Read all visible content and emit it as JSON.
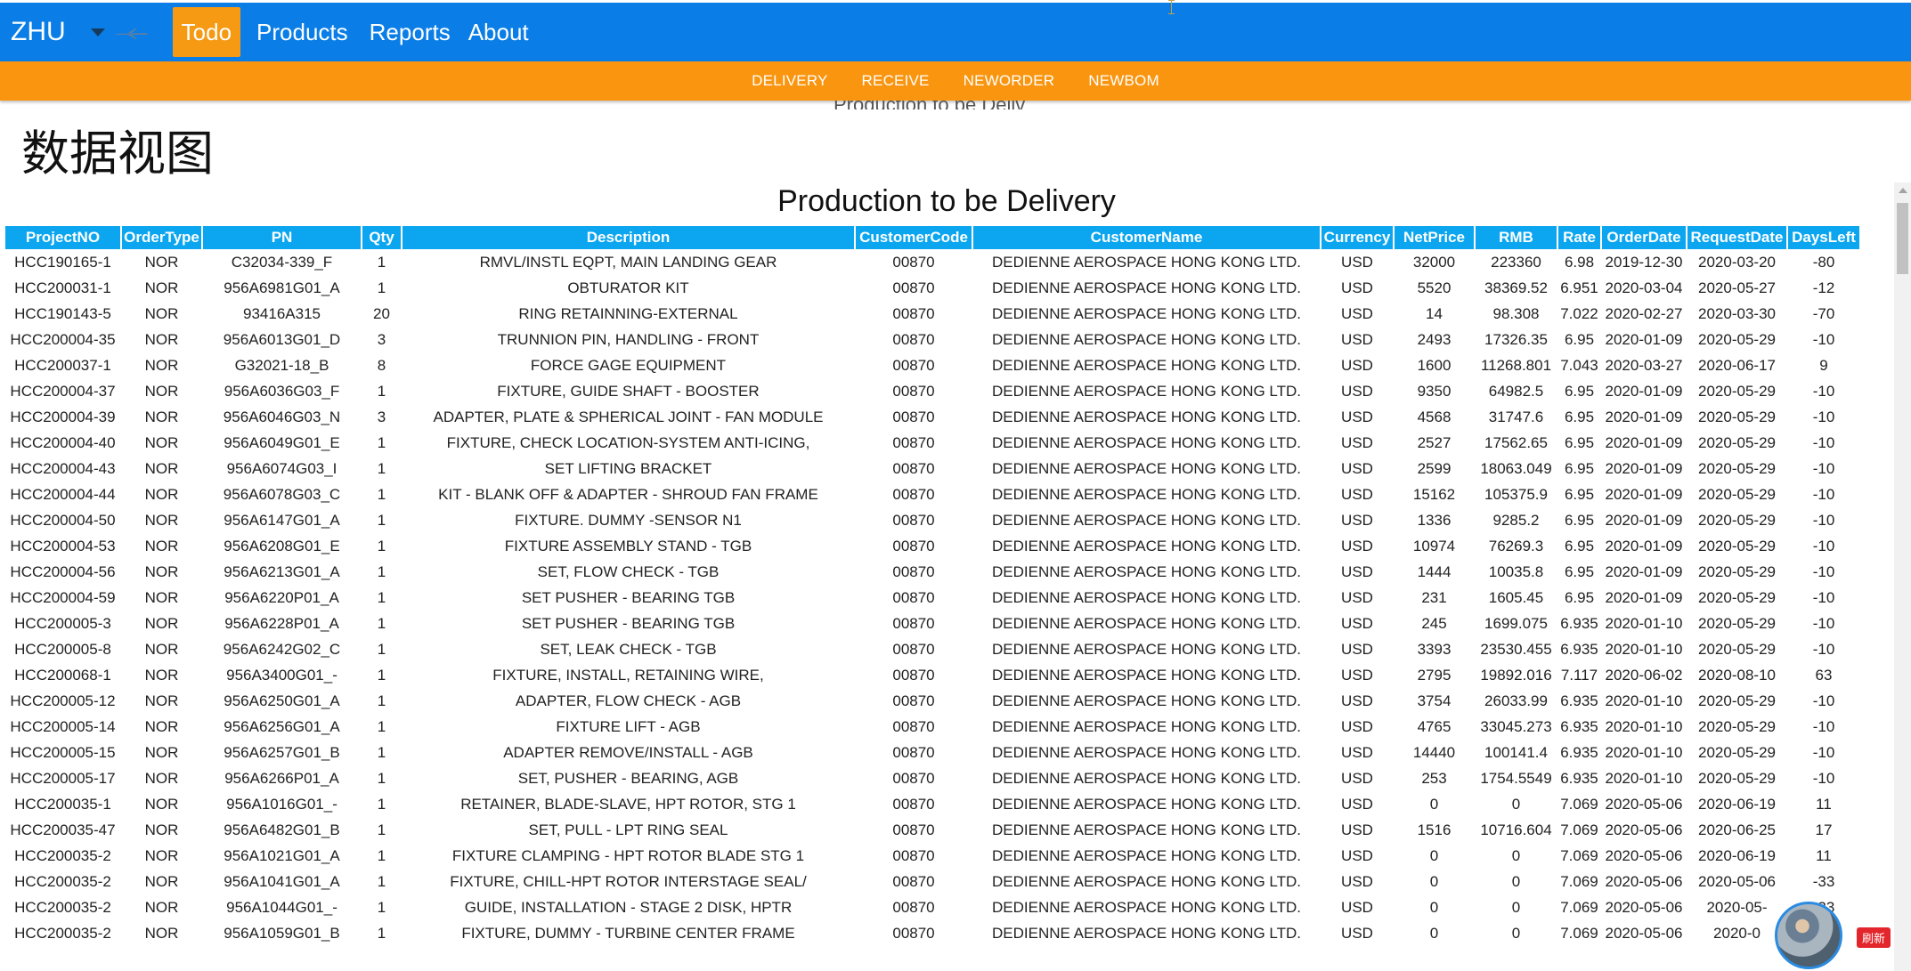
{
  "navbar": {
    "brand": "ZHU",
    "items": [
      {
        "label": "Todo",
        "active": true
      },
      {
        "label": "Products",
        "active": false
      },
      {
        "label": "Reports",
        "active": false
      },
      {
        "label": "About",
        "active": false
      }
    ],
    "color": "#0a7ee6",
    "active_color": "#f59a12"
  },
  "subnav": {
    "items": [
      "DELIVERY",
      "RECEIVE",
      "NEWORDER",
      "NEWBOM"
    ],
    "color": "#fa950f"
  },
  "page": {
    "title": "数据视图",
    "ghost_text": "Production to be Deliv"
  },
  "table": {
    "caption": "Production to be Delivery",
    "header_color": "#0ba6ef",
    "columns": [
      "ProjectNO",
      "OrderType",
      "PN",
      "Qty",
      "Description",
      "CustomerCode",
      "CustomerName",
      "Currency",
      "NetPrice",
      "RMB",
      "Rate",
      "OrderDate",
      "RequestDate",
      "DaysLeft"
    ],
    "rows": [
      [
        "HCC190165-1",
        "NOR",
        "C32034-339_F",
        "1",
        "RMVL/INSTL EQPT, MAIN LANDING GEAR",
        "00870",
        "DEDIENNE AEROSPACE HONG KONG LTD.",
        "USD",
        "32000",
        "223360",
        "6.98",
        "2019-12-30",
        "2020-03-20",
        "-80"
      ],
      [
        "HCC200031-1",
        "NOR",
        "956A6981G01_A",
        "1",
        "OBTURATOR KIT",
        "00870",
        "DEDIENNE AEROSPACE HONG KONG LTD.",
        "USD",
        "5520",
        "38369.52",
        "6.951",
        "2020-03-04",
        "2020-05-27",
        "-12"
      ],
      [
        "HCC190143-5",
        "NOR",
        "93416A315",
        "20",
        "RING RETAINNING-EXTERNAL",
        "00870",
        "DEDIENNE AEROSPACE HONG KONG LTD.",
        "USD",
        "14",
        "98.308",
        "7.022",
        "2020-02-27",
        "2020-03-30",
        "-70"
      ],
      [
        "HCC200004-35",
        "NOR",
        "956A6013G01_D",
        "3",
        "TRUNNION PIN, HANDLING - FRONT",
        "00870",
        "DEDIENNE AEROSPACE HONG KONG LTD.",
        "USD",
        "2493",
        "17326.35",
        "6.95",
        "2020-01-09",
        "2020-05-29",
        "-10"
      ],
      [
        "HCC200037-1",
        "NOR",
        "G32021-18_B",
        "8",
        "FORCE GAGE EQUIPMENT",
        "00870",
        "DEDIENNE AEROSPACE HONG KONG LTD.",
        "USD",
        "1600",
        "11268.801",
        "7.043",
        "2020-03-27",
        "2020-06-17",
        "9"
      ],
      [
        "HCC200004-37",
        "NOR",
        "956A6036G03_F",
        "1",
        "FIXTURE, GUIDE SHAFT - BOOSTER",
        "00870",
        "DEDIENNE AEROSPACE HONG KONG LTD.",
        "USD",
        "9350",
        "64982.5",
        "6.95",
        "2020-01-09",
        "2020-05-29",
        "-10"
      ],
      [
        "HCC200004-39",
        "NOR",
        "956A6046G03_N",
        "3",
        "ADAPTER, PLATE & SPHERICAL JOINT - FAN MODULE",
        "00870",
        "DEDIENNE AEROSPACE HONG KONG LTD.",
        "USD",
        "4568",
        "31747.6",
        "6.95",
        "2020-01-09",
        "2020-05-29",
        "-10"
      ],
      [
        "HCC200004-40",
        "NOR",
        "956A6049G01_E",
        "1",
        "FIXTURE, CHECK LOCATION-SYSTEM ANTI-ICING,",
        "00870",
        "DEDIENNE AEROSPACE HONG KONG LTD.",
        "USD",
        "2527",
        "17562.65",
        "6.95",
        "2020-01-09",
        "2020-05-29",
        "-10"
      ],
      [
        "HCC200004-43",
        "NOR",
        "956A6074G03_I",
        "1",
        "SET LIFTING BRACKET",
        "00870",
        "DEDIENNE AEROSPACE HONG KONG LTD.",
        "USD",
        "2599",
        "18063.049",
        "6.95",
        "2020-01-09",
        "2020-05-29",
        "-10"
      ],
      [
        "HCC200004-44",
        "NOR",
        "956A6078G03_C",
        "1",
        "KIT - BLANK OFF & ADAPTER - SHROUD FAN FRAME",
        "00870",
        "DEDIENNE AEROSPACE HONG KONG LTD.",
        "USD",
        "15162",
        "105375.9",
        "6.95",
        "2020-01-09",
        "2020-05-29",
        "-10"
      ],
      [
        "HCC200004-50",
        "NOR",
        "956A6147G01_A",
        "1",
        "FIXTURE. DUMMY -SENSOR N1",
        "00870",
        "DEDIENNE AEROSPACE HONG KONG LTD.",
        "USD",
        "1336",
        "9285.2",
        "6.95",
        "2020-01-09",
        "2020-05-29",
        "-10"
      ],
      [
        "HCC200004-53",
        "NOR",
        "956A6208G01_E",
        "1",
        "FIXTURE ASSEMBLY STAND - TGB",
        "00870",
        "DEDIENNE AEROSPACE HONG KONG LTD.",
        "USD",
        "10974",
        "76269.3",
        "6.95",
        "2020-01-09",
        "2020-05-29",
        "-10"
      ],
      [
        "HCC200004-56",
        "NOR",
        "956A6213G01_A",
        "1",
        "SET, FLOW CHECK - TGB",
        "00870",
        "DEDIENNE AEROSPACE HONG KONG LTD.",
        "USD",
        "1444",
        "10035.8",
        "6.95",
        "2020-01-09",
        "2020-05-29",
        "-10"
      ],
      [
        "HCC200004-59",
        "NOR",
        "956A6220P01_A",
        "1",
        "SET PUSHER - BEARING TGB",
        "00870",
        "DEDIENNE AEROSPACE HONG KONG LTD.",
        "USD",
        "231",
        "1605.45",
        "6.95",
        "2020-01-09",
        "2020-05-29",
        "-10"
      ],
      [
        "HCC200005-3",
        "NOR",
        "956A6228P01_A",
        "1",
        "SET PUSHER - BEARING TGB",
        "00870",
        "DEDIENNE AEROSPACE HONG KONG LTD.",
        "USD",
        "245",
        "1699.075",
        "6.935",
        "2020-01-10",
        "2020-05-29",
        "-10"
      ],
      [
        "HCC200005-8",
        "NOR",
        "956A6242G02_C",
        "1",
        "SET, LEAK CHECK - TGB",
        "00870",
        "DEDIENNE AEROSPACE HONG KONG LTD.",
        "USD",
        "3393",
        "23530.455",
        "6.935",
        "2020-01-10",
        "2020-05-29",
        "-10"
      ],
      [
        "HCC200068-1",
        "NOR",
        "956A3400G01_-",
        "1",
        "FIXTURE, INSTALL, RETAINING WIRE,",
        "00870",
        "DEDIENNE AEROSPACE HONG KONG LTD.",
        "USD",
        "2795",
        "19892.016",
        "7.117",
        "2020-06-02",
        "2020-08-10",
        "63"
      ],
      [
        "HCC200005-12",
        "NOR",
        "956A6250G01_A",
        "1",
        "ADAPTER, FLOW CHECK - AGB",
        "00870",
        "DEDIENNE AEROSPACE HONG KONG LTD.",
        "USD",
        "3754",
        "26033.99",
        "6.935",
        "2020-01-10",
        "2020-05-29",
        "-10"
      ],
      [
        "HCC200005-14",
        "NOR",
        "956A6256G01_A",
        "1",
        "FIXTURE LIFT - AGB",
        "00870",
        "DEDIENNE AEROSPACE HONG KONG LTD.",
        "USD",
        "4765",
        "33045.273",
        "6.935",
        "2020-01-10",
        "2020-05-29",
        "-10"
      ],
      [
        "HCC200005-15",
        "NOR",
        "956A6257G01_B",
        "1",
        "ADAPTER REMOVE/INSTALL - AGB",
        "00870",
        "DEDIENNE AEROSPACE HONG KONG LTD.",
        "USD",
        "14440",
        "100141.4",
        "6.935",
        "2020-01-10",
        "2020-05-29",
        "-10"
      ],
      [
        "HCC200005-17",
        "NOR",
        "956A6266P01_A",
        "1",
        "SET, PUSHER - BEARING, AGB",
        "00870",
        "DEDIENNE AEROSPACE HONG KONG LTD.",
        "USD",
        "253",
        "1754.5549",
        "6.935",
        "2020-01-10",
        "2020-05-29",
        "-10"
      ],
      [
        "HCC200035-1",
        "NOR",
        "956A1016G01_-",
        "1",
        "RETAINER, BLADE-SLAVE, HPT ROTOR, STG 1",
        "00870",
        "DEDIENNE AEROSPACE HONG KONG LTD.",
        "USD",
        "0",
        "0",
        "7.069",
        "2020-05-06",
        "2020-06-19",
        "11"
      ],
      [
        "HCC200035-47",
        "NOR",
        "956A6482G01_B",
        "1",
        "SET, PULL - LPT RING SEAL",
        "00870",
        "DEDIENNE AEROSPACE HONG KONG LTD.",
        "USD",
        "1516",
        "10716.604",
        "7.069",
        "2020-05-06",
        "2020-06-25",
        "17"
      ],
      [
        "HCC200035-2",
        "NOR",
        "956A1021G01_A",
        "1",
        "FIXTURE CLAMPING - HPT ROTOR BLADE STG 1",
        "00870",
        "DEDIENNE AEROSPACE HONG KONG LTD.",
        "USD",
        "0",
        "0",
        "7.069",
        "2020-05-06",
        "2020-06-19",
        "11"
      ],
      [
        "HCC200035-2",
        "NOR",
        "956A1041G01_A",
        "1",
        "FIXTURE, CHILL-HPT ROTOR INTERSTAGE SEAL/",
        "00870",
        "DEDIENNE AEROSPACE HONG KONG LTD.",
        "USD",
        "0",
        "0",
        "7.069",
        "2020-05-06",
        "2020-05-06",
        "-33"
      ],
      [
        "HCC200035-2",
        "NOR",
        "956A1044G01_-",
        "1",
        "GUIDE, INSTALLATION - STAGE 2 DISK, HPTR",
        "00870",
        "DEDIENNE AEROSPACE HONG KONG LTD.",
        "USD",
        "0",
        "0",
        "7.069",
        "2020-05-06",
        "2020-05-",
        "-33"
      ],
      [
        "HCC200035-2",
        "NOR",
        "956A1059G01_B",
        "1",
        "FIXTURE, DUMMY - TURBINE CENTER FRAME",
        "00870",
        "DEDIENNE AEROSPACE HONG KONG LTD.",
        "USD",
        "0",
        "0",
        "7.069",
        "2020-05-06",
        "2020-0",
        "-3"
      ]
    ]
  },
  "widget": {
    "refresh_label": "刷新"
  }
}
